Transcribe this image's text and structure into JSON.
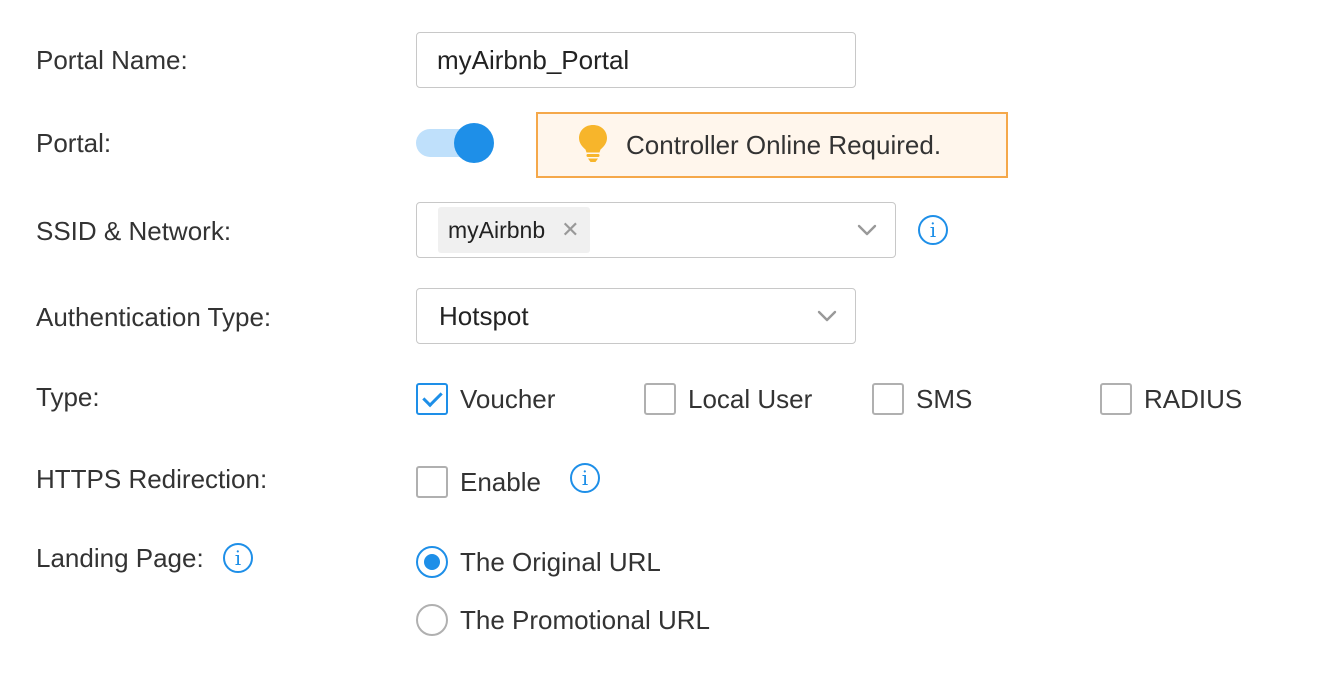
{
  "colors": {
    "accent": "#1e8fe8",
    "notice_border": "#f5a84a",
    "notice_bg": "#fff6ec",
    "bulb": "#f7b52b"
  },
  "portal_name": {
    "label": "Portal Name:",
    "value": "myAirbnb_Portal"
  },
  "portal": {
    "label": "Portal:",
    "enabled": true,
    "notice": {
      "icon": "lightbulb-icon",
      "text": "Controller Online Required."
    }
  },
  "ssid_network": {
    "label": "SSID & Network:",
    "tags": [
      "myAirbnb"
    ],
    "info_icon": "info-icon"
  },
  "auth_type": {
    "label": "Authentication Type:",
    "selected": "Hotspot"
  },
  "type": {
    "label": "Type:",
    "options": [
      {
        "label": "Voucher",
        "checked": true
      },
      {
        "label": "Local User",
        "checked": false
      },
      {
        "label": "SMS",
        "checked": false
      },
      {
        "label": "RADIUS",
        "checked": false
      }
    ]
  },
  "https_redirection": {
    "label": "HTTPS Redirection:",
    "option": "Enable",
    "checked": false
  },
  "landing_page": {
    "label": "Landing Page:",
    "options": [
      {
        "label": "The Original URL",
        "selected": true
      },
      {
        "label": "The Promotional URL",
        "selected": false
      }
    ]
  }
}
